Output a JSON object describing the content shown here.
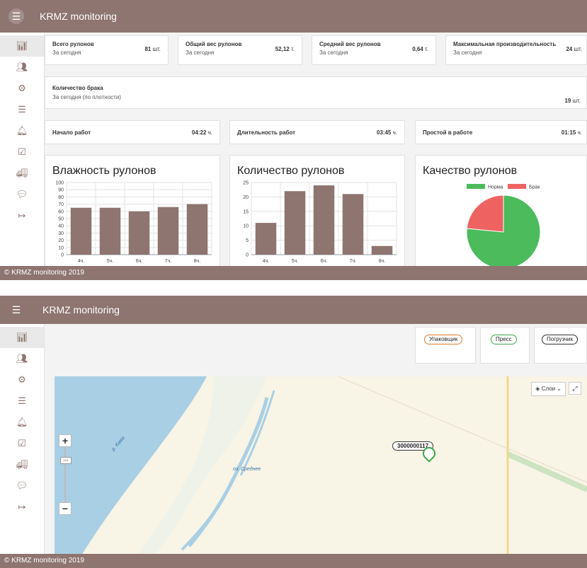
{
  "app": {
    "title": "KRMZ monitoring",
    "footer": "© KRMZ monitoring 2019"
  },
  "icons": {
    "menu": "hamburger-icon",
    "sidebar": [
      "bar-chart-icon",
      "users-icon",
      "users-gear-icon",
      "list-icon",
      "bell-icon",
      "checklist-icon",
      "truck-icon",
      "chat-icon",
      "sign-out-icon"
    ]
  },
  "colors": {
    "brand": "#8e7570",
    "bar": "#8e7570",
    "good": "#4cbb5c",
    "defect": "#ee6361"
  },
  "stats_row1": [
    {
      "title": "Всего рулонов",
      "subtitle": "За сегодня",
      "value": "81",
      "unit": "шт."
    },
    {
      "title": "Общий вес рулонов",
      "subtitle": "За сегодня",
      "value": "52,12",
      "unit": "т."
    },
    {
      "title": "Средний вес рулонов",
      "subtitle": "За сегодня",
      "value": "0,64",
      "unit": "т."
    },
    {
      "title": "Максимальная производительность",
      "subtitle": "За сегодня",
      "value": "24",
      "unit": "шт."
    }
  ],
  "defects": {
    "title": "Количество брака",
    "subtitle": "За сегодня (по плотности)",
    "value": "19",
    "unit": "шт."
  },
  "stats_row3": [
    {
      "title": "Начало работ",
      "value": "04:22",
      "unit": "ч."
    },
    {
      "title": "Длительность работ",
      "value": "03:45",
      "unit": "ч."
    },
    {
      "title": "Простой в работе",
      "value": "01:15",
      "unit": "ч."
    }
  ],
  "chart_data": [
    {
      "type": "bar",
      "title": "Влажность рулонов",
      "categories": [
        "4ч.",
        "5ч.",
        "6ч.",
        "7ч.",
        "8ч."
      ],
      "values": [
        65,
        65,
        60,
        66,
        70
      ],
      "ylim": [
        0,
        100
      ],
      "yticks": [
        0,
        10,
        20,
        30,
        40,
        50,
        60,
        70,
        80,
        90,
        100
      ],
      "grid": true
    },
    {
      "type": "bar",
      "title": "Количество рулонов",
      "categories": [
        "4ч.",
        "5ч.",
        "6ч.",
        "7ч.",
        "8ч."
      ],
      "values": [
        11,
        22,
        24,
        21,
        3
      ],
      "ylim": [
        0,
        25
      ],
      "yticks": [
        0,
        5,
        10,
        15,
        20,
        25
      ],
      "grid": true
    },
    {
      "type": "pie",
      "title": "Качество рулонов",
      "legend": [
        "Норма",
        "Брак"
      ],
      "values": [
        62,
        19
      ]
    }
  ],
  "map_page": {
    "filters": [
      "Упаковщик",
      "Пресс",
      "Погрузчик"
    ],
    "layers_label": "Слои",
    "zoom_in": "+",
    "zoom_out": "−",
    "zoom_level": "101",
    "labels": {
      "river": "р. Кама",
      "lake": "оз. Среднее"
    },
    "marker": "3000000117"
  }
}
